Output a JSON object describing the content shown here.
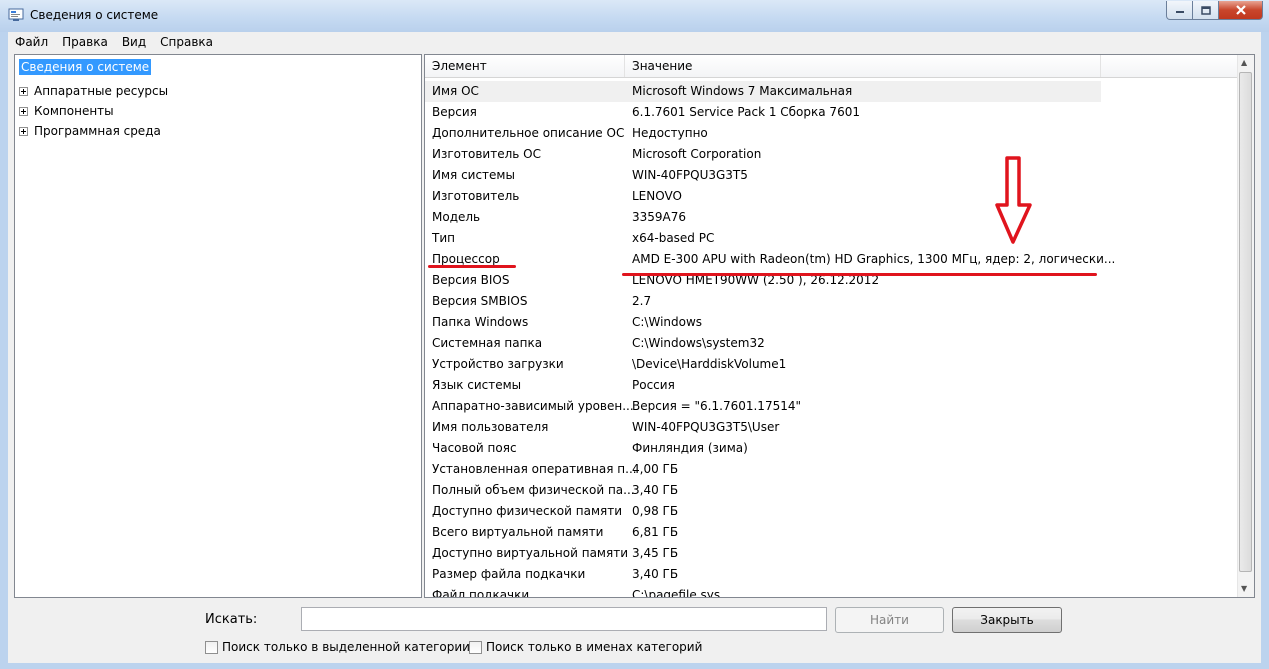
{
  "window": {
    "title": "Сведения о системе"
  },
  "menu": [
    "Файл",
    "Правка",
    "Вид",
    "Справка"
  ],
  "tree": {
    "root": "Сведения о системе",
    "children": [
      "Аппаратные ресурсы",
      "Компоненты",
      "Программная среда"
    ]
  },
  "table": {
    "columns": [
      "Элемент",
      "Значение"
    ],
    "rows": [
      [
        "Имя ОС",
        "Microsoft Windows 7 Максимальная"
      ],
      [
        "Версия",
        "6.1.7601 Service Pack 1 Сборка 7601"
      ],
      [
        "Дополнительное описание ОС",
        "Недоступно"
      ],
      [
        "Изготовитель ОС",
        "Microsoft Corporation"
      ],
      [
        "Имя системы",
        "WIN-40FPQU3G3T5"
      ],
      [
        "Изготовитель",
        "LENOVO"
      ],
      [
        "Модель",
        "3359A76"
      ],
      [
        "Тип",
        "x64-based PC"
      ],
      [
        "Процессор",
        "AMD E-300 APU with Radeon(tm) HD Graphics, 1300 МГц, ядер: 2, логически..."
      ],
      [
        "Версия BIOS",
        "LENOVO HMET90WW (2.50 ), 26.12.2012"
      ],
      [
        "Версия SMBIOS",
        "2.7"
      ],
      [
        "Папка Windows",
        "C:\\Windows"
      ],
      [
        "Системная папка",
        "C:\\Windows\\system32"
      ],
      [
        "Устройство загрузки",
        "\\Device\\HarddiskVolume1"
      ],
      [
        "Язык системы",
        "Россия"
      ],
      [
        "Аппаратно-зависимый уровен...",
        "Версия = \"6.1.7601.17514\""
      ],
      [
        "Имя пользователя",
        "WIN-40FPQU3G3T5\\User"
      ],
      [
        "Часовой пояс",
        "Финляндия (зима)"
      ],
      [
        "Установленная оперативная п...",
        "4,00 ГБ"
      ],
      [
        "Полный объем физической па...",
        "3,40 ГБ"
      ],
      [
        "Доступно физической памяти",
        "0,98 ГБ"
      ],
      [
        "Всего виртуальной памяти",
        "6,81 ГБ"
      ],
      [
        "Доступно виртуальной памяти",
        "3,45 ГБ"
      ],
      [
        "Размер файла подкачки",
        "3,40 ГБ"
      ],
      [
        "Файл подкачки",
        "C:\\pagefile.sys"
      ]
    ]
  },
  "search": {
    "label": "Искать:",
    "value": ""
  },
  "buttons": {
    "find": "Найти",
    "close": "Закрыть"
  },
  "checkboxes": [
    "Поиск только в выделенной категории",
    "Поиск только в именах категорий"
  ],
  "annotation": {
    "color": "#e0141d",
    "arrow_icon": "down-arrow-outline-icon"
  }
}
